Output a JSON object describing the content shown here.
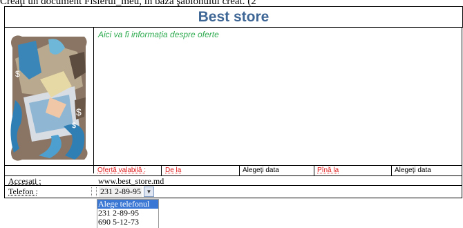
{
  "header_line": "Creaţi un document Fisierul_meu, în baza şablonului creat. (2",
  "template": {
    "title": "Best store",
    "offer_info": "Aici va fi informația despre oferte",
    "offer_row": {
      "valid_label": "Ofertă valabilă :",
      "from_label": "De la",
      "from_date_prompt": "Alegeţi data",
      "to_label": "Pînă la",
      "to_date_prompt": "Alegeţi data"
    },
    "access": {
      "label": "Accesaţi :",
      "value": "www.best_store.md"
    },
    "phone": {
      "label": "Telefon :",
      "selected_value": "231 2-89-95",
      "options": [
        "Alege telefonul",
        "231 2-89-95",
        "690 5-12-73"
      ]
    }
  },
  "colors": {
    "title": "#3f6796",
    "offer_text": "#2eab4f",
    "labels_red": "#e01b1b",
    "dropdown_highlight": "#3a77d5"
  }
}
